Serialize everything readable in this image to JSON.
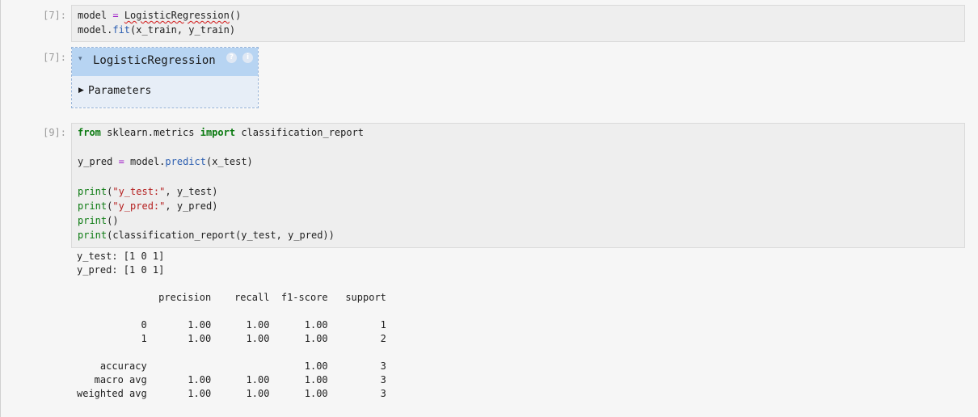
{
  "cells": [
    {
      "prompt": "[7]:",
      "code": {
        "l1_model": "model",
        "l1_eq": " = ",
        "l1_cls": "LogisticRegression",
        "l1_parens": "()",
        "l2_obj": "model.",
        "l2_fn": "fit",
        "l2_args": "(x_train, y_train)"
      }
    },
    {
      "prompt": "[7]:",
      "estimator": {
        "name": "LogisticRegression",
        "chevron": "▾",
        "badge_help": "?",
        "badge_fitted": "i",
        "section_arrow": "▶",
        "section_label": "Parameters"
      }
    },
    {
      "prompt": "[9]:",
      "code": {
        "l1_from": "from",
        "l1_mod": " sklearn.metrics ",
        "l1_import": "import",
        "l1_name": " classification_report",
        "l3_var": "y_pred",
        "l3_eq": " = ",
        "l3_obj": "model.",
        "l3_fn": "predict",
        "l3_args": "(x_test)",
        "print": "print",
        "l5_str": "\"y_test:\"",
        "l5_rest": ", y_test)",
        "l6_str": "\"y_pred:\"",
        "l6_rest": ", y_pred)",
        "l7_rest": "()",
        "l8_rest": "(classification_report(y_test, y_pred))",
        "open_paren": "("
      },
      "output": "y_test: [1 0 1]\ny_pred: [1 0 1]\n\n              precision    recall  f1-score   support\n\n           0       1.00      1.00      1.00         1\n           1       1.00      1.00      1.00         2\n\n    accuracy                           1.00         3\n   macro avg       1.00      1.00      1.00         3\nweighted avg       1.00      1.00      1.00         3"
    }
  ],
  "colors": {
    "keyword": "#0a7a10",
    "operator": "#a020c8",
    "function": "#2a5db0",
    "string": "#b52020",
    "estimator_header": "#b7d4f2",
    "estimator_body": "#e7eef7"
  }
}
